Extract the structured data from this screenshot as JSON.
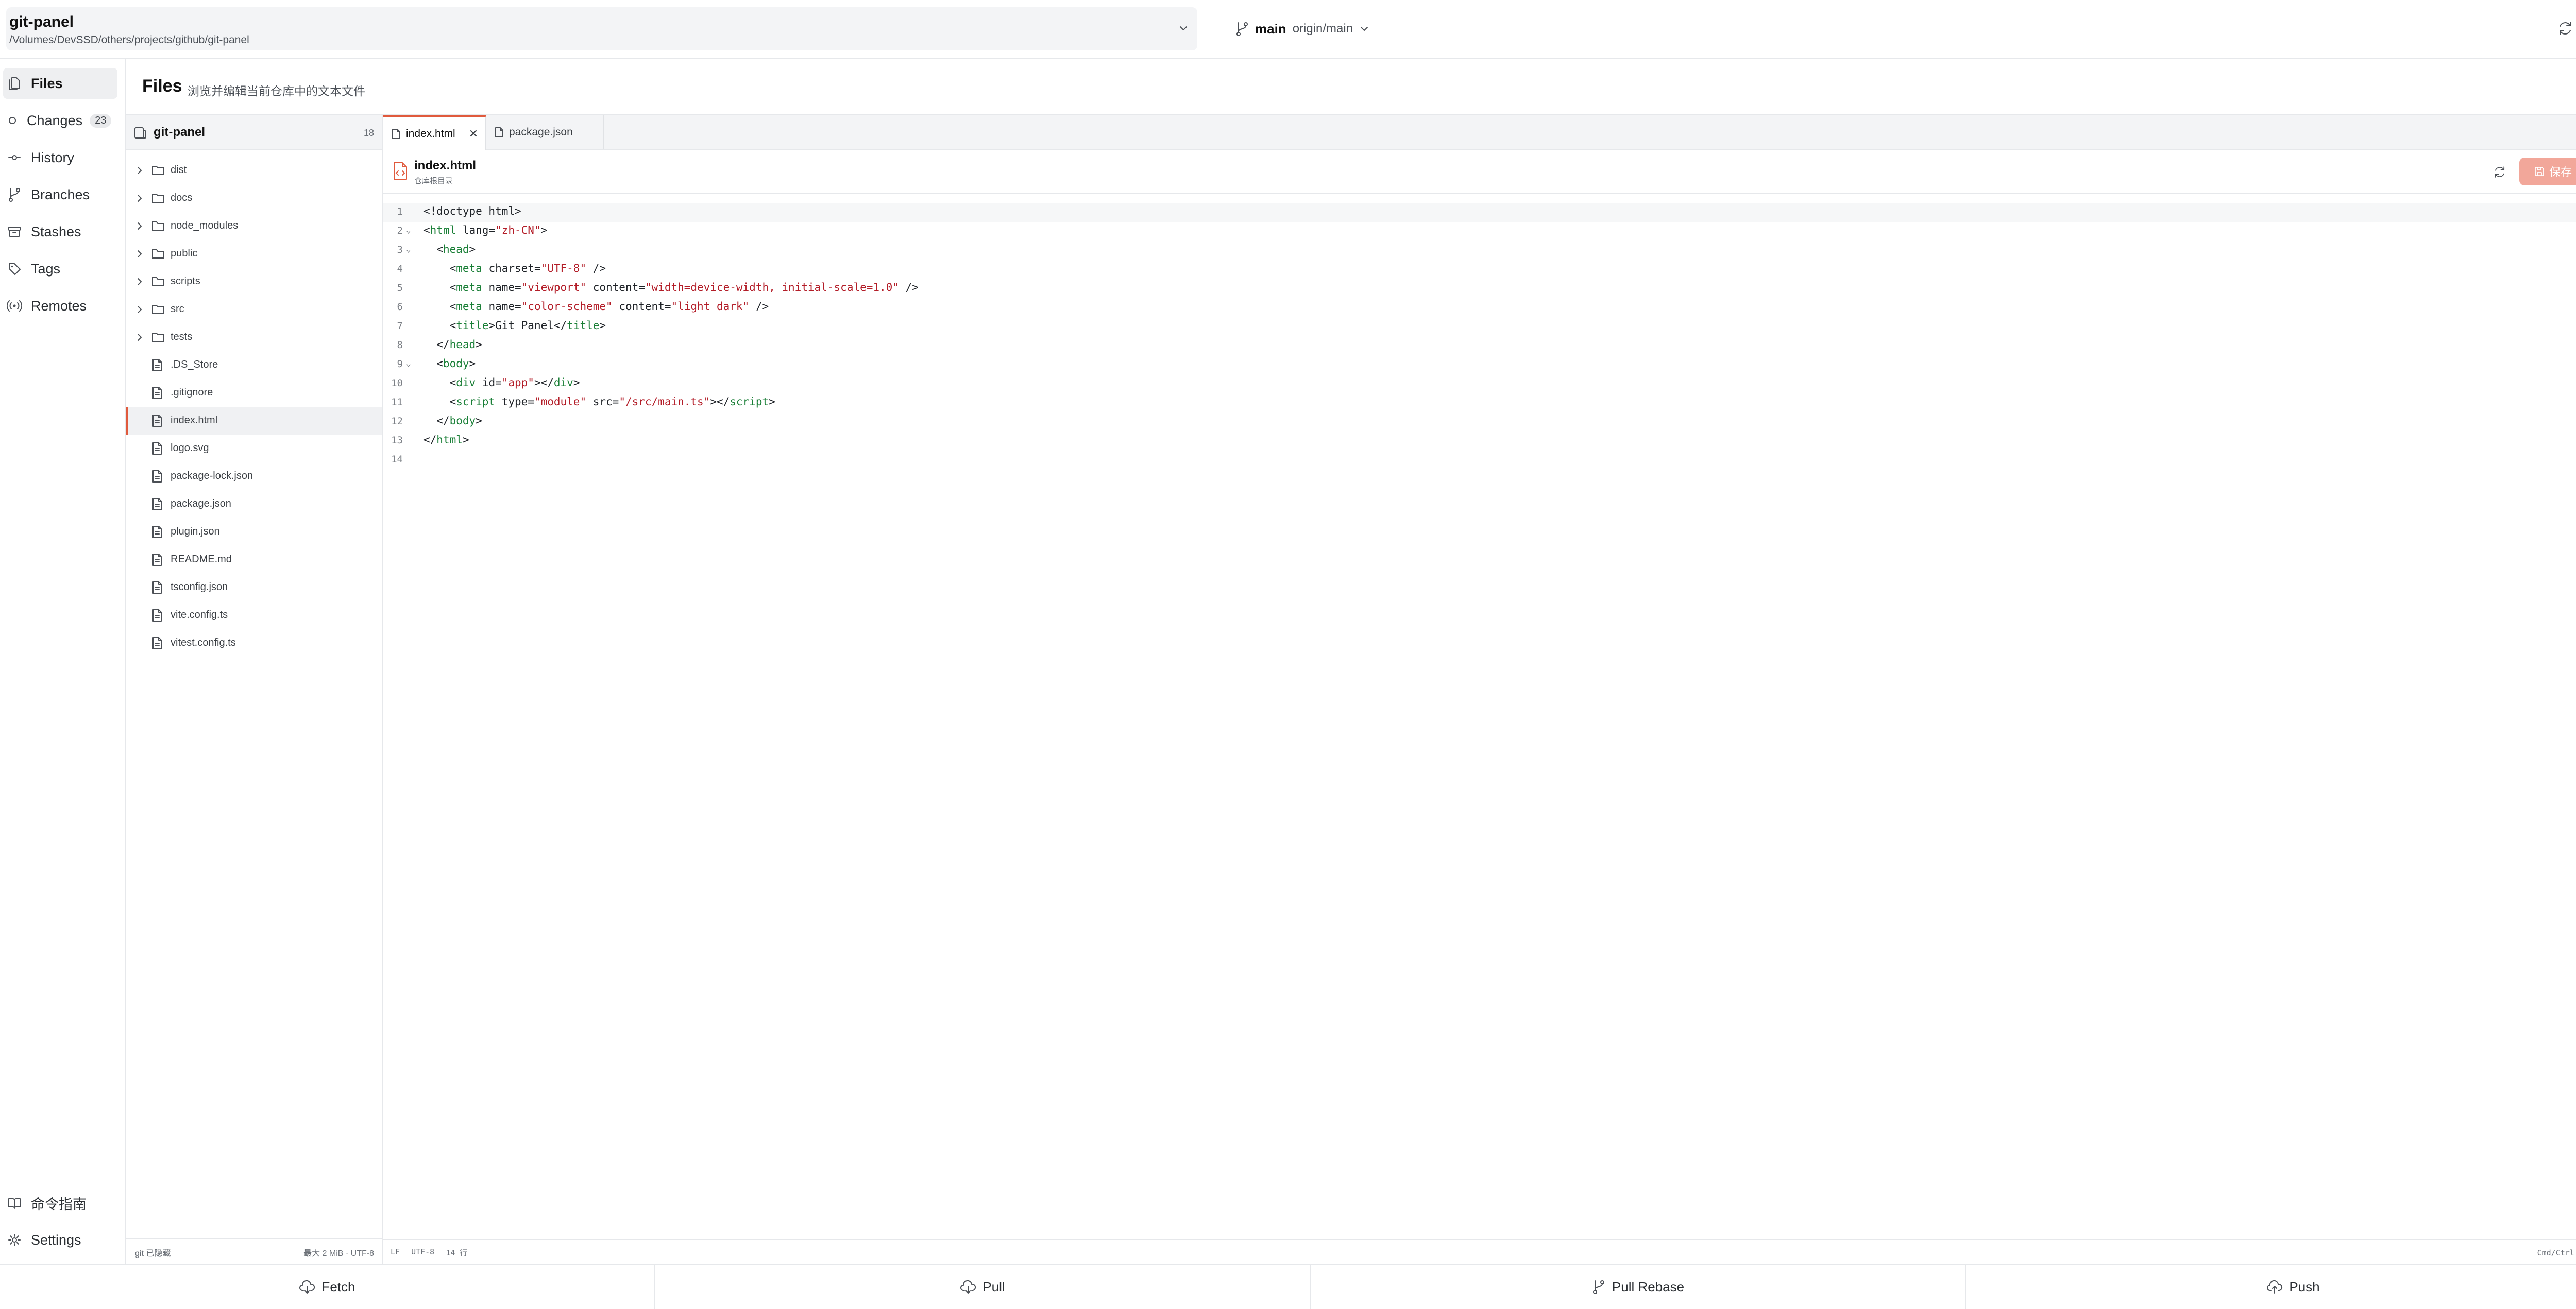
{
  "repo": {
    "name": "git-panel",
    "path": "/Volumes/DevSSD/others/projects/github/git-panel"
  },
  "branch": {
    "name": "main",
    "upstream": "origin/main"
  },
  "sidebar": {
    "items": [
      {
        "label": "Files",
        "icon": "files-icon",
        "active": true
      },
      {
        "label": "Changes",
        "icon": "changes-dot-icon",
        "badge": "23"
      },
      {
        "label": "History",
        "icon": "history-icon"
      },
      {
        "label": "Branches",
        "icon": "branches-icon"
      },
      {
        "label": "Stashes",
        "icon": "stashes-icon"
      },
      {
        "label": "Tags",
        "icon": "tag-icon"
      },
      {
        "label": "Remotes",
        "icon": "remotes-icon"
      }
    ],
    "bottom": [
      {
        "label": "命令指南",
        "icon": "book-icon"
      },
      {
        "label": "Settings",
        "icon": "gear-icon"
      }
    ]
  },
  "files_header": {
    "title": "Files",
    "subtitle": "浏览并编辑当前仓库中的文本文件"
  },
  "tree": {
    "root": "git-panel",
    "count": "18",
    "items": [
      {
        "name": "dist",
        "type": "folder"
      },
      {
        "name": "docs",
        "type": "folder"
      },
      {
        "name": "node_modules",
        "type": "folder"
      },
      {
        "name": "public",
        "type": "folder"
      },
      {
        "name": "scripts",
        "type": "folder"
      },
      {
        "name": "src",
        "type": "folder"
      },
      {
        "name": "tests",
        "type": "folder"
      },
      {
        "name": ".DS_Store",
        "type": "file"
      },
      {
        "name": ".gitignore",
        "type": "file"
      },
      {
        "name": "index.html",
        "type": "file",
        "selected": true
      },
      {
        "name": "logo.svg",
        "type": "file"
      },
      {
        "name": "package-lock.json",
        "type": "file"
      },
      {
        "name": "package.json",
        "type": "file"
      },
      {
        "name": "plugin.json",
        "type": "file"
      },
      {
        "name": "README.md",
        "type": "file"
      },
      {
        "name": "tsconfig.json",
        "type": "file"
      },
      {
        "name": "vite.config.ts",
        "type": "file"
      },
      {
        "name": "vitest.config.ts",
        "type": "file"
      }
    ],
    "footer_left": "git 已隐藏",
    "footer_right": "最大 2 MiB · UTF-8"
  },
  "tabs": [
    {
      "label": "index.html",
      "active": true
    },
    {
      "label": "package.json",
      "active": false
    }
  ],
  "editor": {
    "file_name": "index.html",
    "file_sub": "仓库根目录",
    "save_label": "保存",
    "current_line": 1,
    "lines": [
      {
        "n": "1",
        "fold": "",
        "segments": [
          [
            "t",
            "<!doctype html>"
          ]
        ]
      },
      {
        "n": "2",
        "fold": "⌄",
        "segments": [
          [
            "t",
            "<"
          ],
          [
            "g",
            "html"
          ],
          [
            "t",
            " lang="
          ],
          [
            "s",
            "\"zh-CN\""
          ],
          [
            "t",
            ">"
          ]
        ]
      },
      {
        "n": "3",
        "fold": "⌄",
        "segments": [
          [
            "t",
            "  <"
          ],
          [
            "g",
            "head"
          ],
          [
            "t",
            ">"
          ]
        ]
      },
      {
        "n": "4",
        "fold": "",
        "segments": [
          [
            "t",
            "    <"
          ],
          [
            "g",
            "meta"
          ],
          [
            "t",
            " charset="
          ],
          [
            "s",
            "\"UTF-8\""
          ],
          [
            "t",
            " />"
          ]
        ]
      },
      {
        "n": "5",
        "fold": "",
        "segments": [
          [
            "t",
            "    <"
          ],
          [
            "g",
            "meta"
          ],
          [
            "t",
            " name="
          ],
          [
            "s",
            "\"viewport\""
          ],
          [
            "t",
            " content="
          ],
          [
            "s",
            "\"width=device-width, initial-scale=1.0\""
          ],
          [
            "t",
            " />"
          ]
        ]
      },
      {
        "n": "6",
        "fold": "",
        "segments": [
          [
            "t",
            "    <"
          ],
          [
            "g",
            "meta"
          ],
          [
            "t",
            " name="
          ],
          [
            "s",
            "\"color-scheme\""
          ],
          [
            "t",
            " content="
          ],
          [
            "s",
            "\"light dark\""
          ],
          [
            "t",
            " />"
          ]
        ]
      },
      {
        "n": "7",
        "fold": "",
        "segments": [
          [
            "t",
            "    <"
          ],
          [
            "g",
            "title"
          ],
          [
            "t",
            ">Git Panel</"
          ],
          [
            "g",
            "title"
          ],
          [
            "t",
            ">"
          ]
        ]
      },
      {
        "n": "8",
        "fold": "",
        "segments": [
          [
            "t",
            "  </"
          ],
          [
            "g",
            "head"
          ],
          [
            "t",
            ">"
          ]
        ]
      },
      {
        "n": "9",
        "fold": "⌄",
        "segments": [
          [
            "t",
            "  <"
          ],
          [
            "g",
            "body"
          ],
          [
            "t",
            ">"
          ]
        ]
      },
      {
        "n": "10",
        "fold": "",
        "segments": [
          [
            "t",
            "    <"
          ],
          [
            "g",
            "div"
          ],
          [
            "t",
            " id="
          ],
          [
            "s",
            "\"app\""
          ],
          [
            "t",
            "></"
          ],
          [
            "g",
            "div"
          ],
          [
            "t",
            ">"
          ]
        ]
      },
      {
        "n": "11",
        "fold": "",
        "segments": [
          [
            "t",
            "    <"
          ],
          [
            "g",
            "script"
          ],
          [
            "t",
            " type="
          ],
          [
            "s",
            "\"module\""
          ],
          [
            "t",
            " src="
          ],
          [
            "s",
            "\"/src/main.ts\""
          ],
          [
            "t",
            "></"
          ],
          [
            "g",
            "script"
          ],
          [
            "t",
            ">"
          ]
        ]
      },
      {
        "n": "12",
        "fold": "",
        "segments": [
          [
            "t",
            "  </"
          ],
          [
            "g",
            "body"
          ],
          [
            "t",
            ">"
          ]
        ]
      },
      {
        "n": "13",
        "fold": "",
        "segments": [
          [
            "t",
            "</"
          ],
          [
            "g",
            "html"
          ],
          [
            "t",
            ">"
          ]
        ]
      },
      {
        "n": "14",
        "fold": "",
        "segments": [
          [
            "t",
            ""
          ]
        ]
      }
    ]
  },
  "status": {
    "eol": "LF",
    "encoding": "UTF-8",
    "lines": "14 行",
    "hint": "Cmd/Ctrl + S 保存"
  },
  "actions": [
    {
      "label": "Fetch",
      "icon": "cloud-fetch-icon"
    },
    {
      "label": "Pull",
      "icon": "cloud-pull-icon"
    },
    {
      "label": "Pull Rebase",
      "icon": "branch-rebase-icon"
    },
    {
      "label": "Push",
      "icon": "cloud-push-icon"
    }
  ],
  "colors": {
    "accent": "#e05a3d",
    "save_disabled": "#f2a79a",
    "tag": "#1a7f37",
    "string": "#b31d28"
  }
}
